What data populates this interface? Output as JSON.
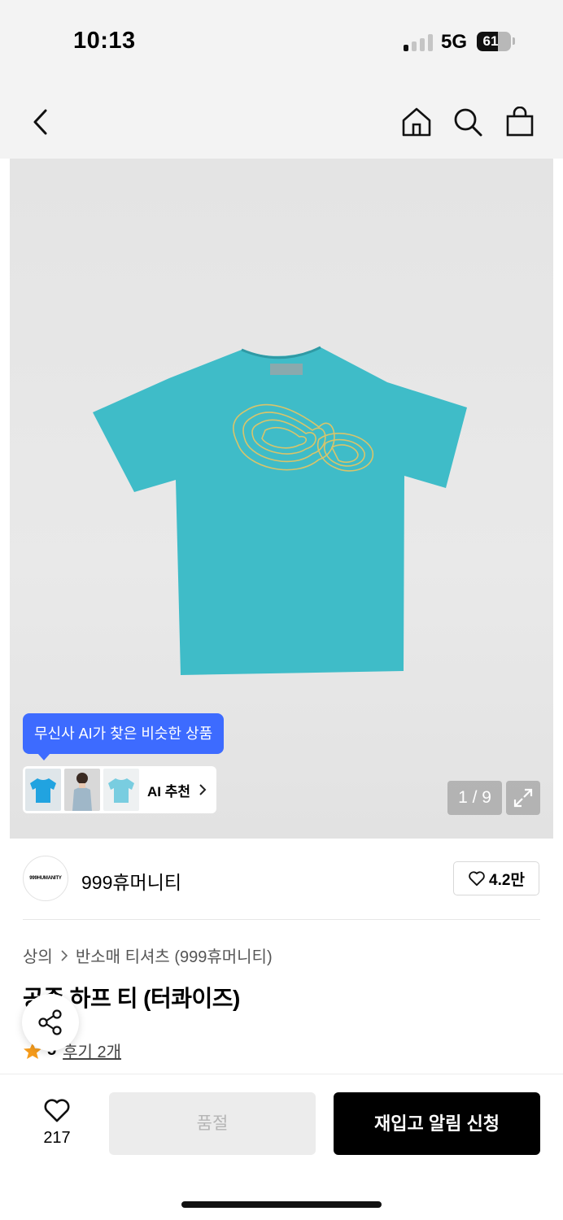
{
  "status_bar": {
    "time": "10:13",
    "network": "5G",
    "battery": "61",
    "battery_level": 0.61
  },
  "nav": {
    "icons": [
      "back-icon",
      "home-icon",
      "search-icon",
      "bag-icon"
    ]
  },
  "gallery": {
    "ai_tooltip": "무신사 AI가 찾은 비슷한 상품",
    "ai_label": "AI 추천",
    "page_counter": "1 / 9",
    "product_color": "#3fbcc8"
  },
  "brand": {
    "logo_text": "999HUMANITY",
    "name": "999휴머니티",
    "likes": "4.2만"
  },
  "breadcrumb": {
    "category": "상의",
    "subcategory": "반소매 티셔츠 (999휴머니티)"
  },
  "product": {
    "title": "공존 하프 티 (터콰이즈)",
    "rating": "5",
    "reviews": "후기 2개"
  },
  "bottom": {
    "wish_count": "217",
    "soldout_label": "품절",
    "restock_label": "재입고 알림 신청"
  },
  "colors": {
    "accent_blue": "#3d6bff",
    "star": "#f59b1b",
    "black": "#000000"
  }
}
